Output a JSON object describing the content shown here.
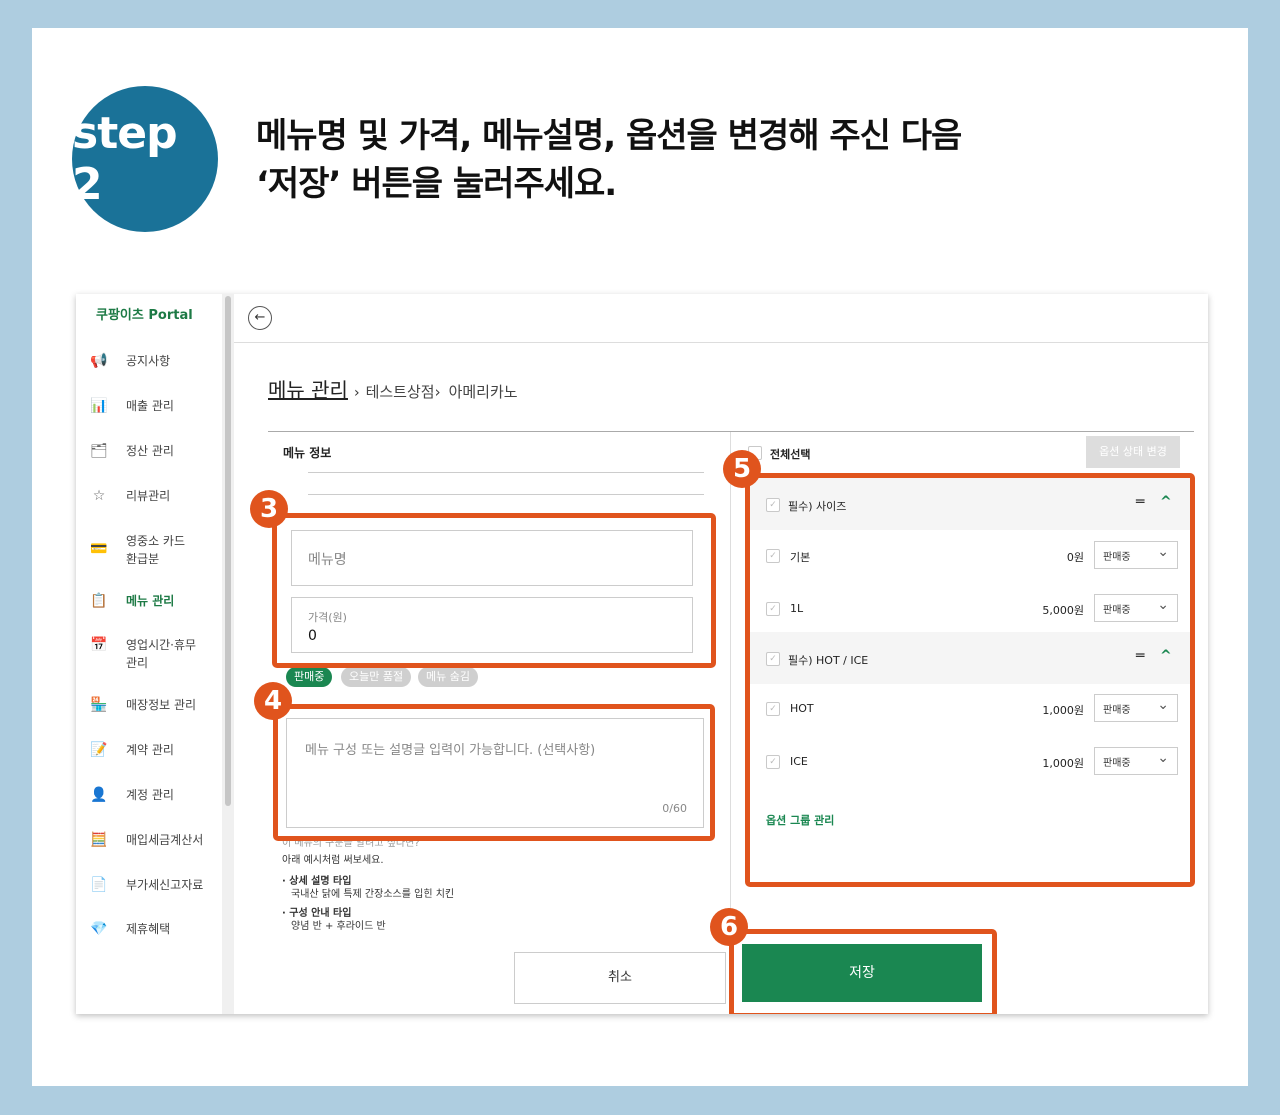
{
  "step": "step 2",
  "headline": {
    "line1": "메뉴명 및 가격, 메뉴설명, 옵션을 변경해 주신 다음",
    "line2": "‘저장’ 버튼을 눌러주세요."
  },
  "sidebar": {
    "brand": "쿠팡이츠 Portal",
    "items": [
      {
        "label": "공지사항",
        "icon": "megaphone-icon",
        "glyph": "📢"
      },
      {
        "label": "매출 관리",
        "icon": "bar-chart-icon",
        "glyph": "📊"
      },
      {
        "label": "정산 관리",
        "icon": "wallet-icon",
        "glyph": "🗂"
      },
      {
        "label": "리뷰관리",
        "icon": "star-search-icon",
        "glyph": "☆"
      },
      {
        "label": "영중소 카드",
        "label2": "환급분",
        "icon": "card-icon",
        "glyph": "💳"
      },
      {
        "label": "메뉴 관리",
        "icon": "clipboard-icon",
        "glyph": "📋"
      },
      {
        "label": "영업시간·휴무",
        "label2": "관리",
        "icon": "calendar-icon",
        "glyph": "📅"
      },
      {
        "label": "매장정보 관리",
        "icon": "store-icon",
        "glyph": "🏪"
      },
      {
        "label": "계약 관리",
        "icon": "contract-icon",
        "glyph": "📝"
      },
      {
        "label": "계정 관리",
        "icon": "user-icon",
        "glyph": "👤"
      },
      {
        "label": "매입세금계산서",
        "icon": "calculator-icon",
        "glyph": "🧮"
      },
      {
        "label": "부가세신고자료",
        "icon": "document-icon",
        "glyph": "📄"
      },
      {
        "label": "제휴혜택",
        "icon": "diamond-icon",
        "glyph": "💎"
      }
    ]
  },
  "breadcrumb": {
    "main": "메뉴 관리",
    "sep1": "›",
    "store": "테스트상점›",
    "item": "아메리카노"
  },
  "menu_info": {
    "section_title": "메뉴 정보",
    "name_placeholder": "메뉴명",
    "price_label": "가격(원)",
    "price_value": "0",
    "status_selling": "판매중",
    "status_soldout": "오늘만 품절",
    "status_hidden": "메뉴 숨김",
    "desc_placeholder": "메뉴 구성 또는 설명글 입력이 가능합니다. (선택사항)",
    "desc_counter": "0/60",
    "help_q": "이 메뉴의 구분을 알려고 싶다면?",
    "help_sub": "아래 예시처럼 써보세요.",
    "ex1_title": "· 상세 설명 타입",
    "ex1_body": "국내산 닭에 특제 간장소스를 입힌 치킨",
    "ex2_title": "· 구성 안내 타입",
    "ex2_body": "양념 반 + 후라이드 반"
  },
  "options": {
    "select_all": "전체선택",
    "state_button": "옵션 상태 변경",
    "groups": [
      {
        "title": "필수) 사이즈",
        "rows": [
          {
            "name": "기본",
            "price": "0원",
            "status": "판매중"
          },
          {
            "name": "1L",
            "price": "5,000원",
            "status": "판매중"
          }
        ]
      },
      {
        "title": "필수) HOT / ICE",
        "rows": [
          {
            "name": "HOT",
            "price": "1,000원",
            "status": "판매중"
          },
          {
            "name": "ICE",
            "price": "1,000원",
            "status": "판매중"
          }
        ]
      }
    ],
    "group_manage": "옵션 그룹 관리"
  },
  "buttons": {
    "cancel": "취소",
    "save": "저장"
  },
  "markers": [
    "3",
    "4",
    "5",
    "6"
  ],
  "colors": {
    "brand_green": "#1a8751",
    "highlight": "#e0541d",
    "badge": "#1a7298",
    "frame": "#aecde0"
  }
}
